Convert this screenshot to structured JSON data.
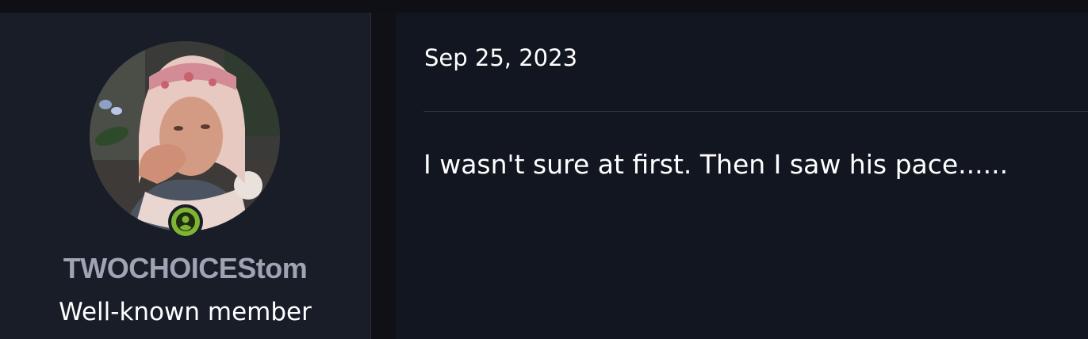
{
  "post": {
    "date": "Sep 25, 2023",
    "body": "I wasn't sure at first. Then I saw his pace......"
  },
  "user": {
    "username": "TWOCHOICEStom",
    "title": "Well-known member",
    "status_icon": "online-user-icon",
    "status_color": "#7fb432"
  },
  "colors": {
    "page_bg": "#0f1116",
    "user_panel_bg": "#181d28",
    "content_bg": "#121620",
    "username_color": "#9ea4b3"
  }
}
